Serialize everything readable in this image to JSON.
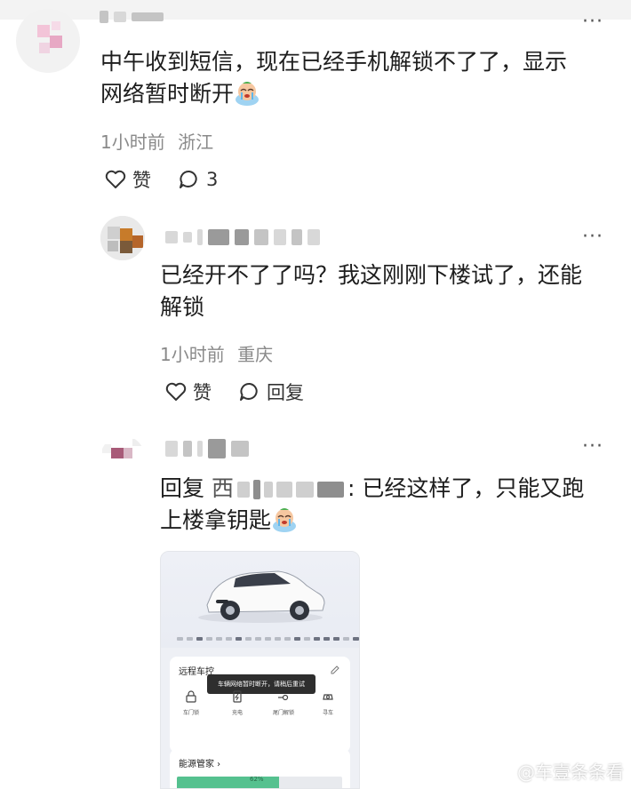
{
  "comment1": {
    "text_line1": "中午收到短信，现在已经手机解锁不了了，显示",
    "text_line2": "网络暂时断开",
    "time": "1小时前",
    "location": "浙江",
    "like_label": "赞",
    "reply_count": "3",
    "more_label": "···"
  },
  "comment2": {
    "text_line1": "已经开不了了吗？我这刚刚下楼试了，还能",
    "text_line2": "解锁",
    "time": "1小时前",
    "location": "重庆",
    "like_label": "赞",
    "reply_label": "回复",
    "more_label": "···"
  },
  "comment3": {
    "reply_prefix": "回复",
    "reply_target_char": "西",
    "text_after_name": ": 已经这样了，只能又跑",
    "text_line2": "上楼拿钥匙",
    "more_label": "···"
  },
  "screenshot": {
    "remote_title": "远程车控",
    "toast": "车辆网络暂时断开，请稍后重试",
    "controls": [
      "车门锁",
      "充电",
      "尾门解锁",
      "寻车"
    ],
    "energy_title": "能源管家",
    "battery_percent": "62%",
    "battery_fraction": 0.62
  },
  "watermark": {
    "text": "@车壹条条看"
  },
  "colors": {
    "text": "#1d1d1d",
    "meta": "#8a8a8a",
    "battery_green": "#55c18f"
  }
}
